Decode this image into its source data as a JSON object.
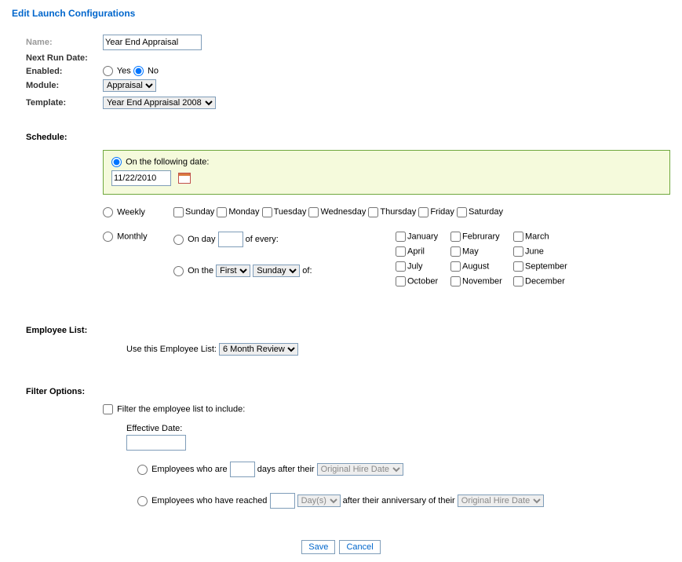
{
  "title": "Edit Launch Configurations",
  "labels": {
    "name": "Name:",
    "nextRunDate": "Next Run Date:",
    "enabled": "Enabled:",
    "module": "Module:",
    "template": "Template:",
    "schedule": "Schedule:",
    "employeeList": "Employee List:",
    "filterOptions": "Filter Options:",
    "useEmployeeList": "Use this Employee List:",
    "filterInclude": "Filter the employee list to include:",
    "effectiveDate": "Effective Date:",
    "empWhoAre": "Employees who are",
    "daysAfterTheir": "days after their",
    "empWhoReached": "Employees who have reached",
    "afterAnniversary": "after their anniversary of their"
  },
  "fields": {
    "name": "Year End Appraisal",
    "enabledYes": "Yes",
    "enabledNo": "No",
    "moduleSelected": "Appraisal",
    "templateSelected": "Year End Appraisal 2008",
    "employeeListSelected": "6 Month Review",
    "dateValue": "11/22/2010",
    "effectiveDate": "",
    "daysAfter": "",
    "anniversaryCount": ""
  },
  "schedule": {
    "onFollowingDate": "On the following date:",
    "weekly": "Weekly",
    "monthly": "Monthly",
    "onDay": "On day",
    "ofEvery": "of every:",
    "onThe": "On the",
    "of": "of:",
    "ordinalSelected": "First",
    "weekdaySelected": "Sunday",
    "days": [
      "Sunday",
      "Monday",
      "Tuesday",
      "Wednesday",
      "Thursday",
      "Friday",
      "Saturday"
    ],
    "months": [
      "January",
      "Februrary",
      "March",
      "April",
      "May",
      "June",
      "July",
      "August",
      "September",
      "October",
      "November",
      "December"
    ]
  },
  "selects": {
    "dateType1": "Original Hire Date",
    "anniversaryUnit": "Day(s)",
    "dateType2": "Original Hire Date"
  },
  "buttons": {
    "save": "Save",
    "cancel": "Cancel"
  }
}
